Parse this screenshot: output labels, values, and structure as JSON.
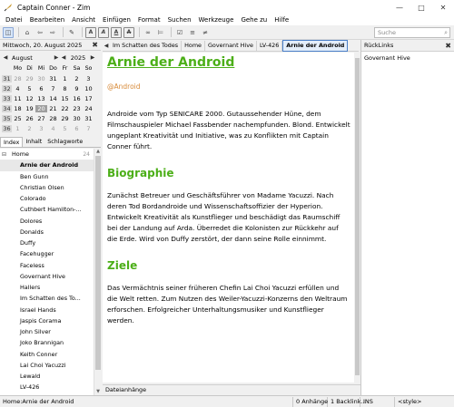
{
  "window": {
    "title": "Captain Conner - Zim"
  },
  "menu": [
    "Datei",
    "Bearbeiten",
    "Ansicht",
    "Einfügen",
    "Format",
    "Suchen",
    "Werkzeuge",
    "Gehe zu",
    "Hilfe"
  ],
  "toolbar": {
    "search_placeholder": "Suche"
  },
  "sidebar": {
    "date": "Mittwoch, 20. August 2025",
    "calendar": {
      "month": "August",
      "year": "2025",
      "weekdays": [
        "Mo",
        "Di",
        "Mi",
        "Do",
        "Fr",
        "Sa",
        "So"
      ],
      "weeks": [
        {
          "wk": "31",
          "days": [
            "28",
            "29",
            "30",
            "31",
            "1",
            "2",
            "3"
          ]
        },
        {
          "wk": "32",
          "days": [
            "4",
            "5",
            "6",
            "7",
            "8",
            "9",
            "10"
          ]
        },
        {
          "wk": "33",
          "days": [
            "11",
            "12",
            "13",
            "14",
            "15",
            "16",
            "17"
          ]
        },
        {
          "wk": "34",
          "days": [
            "18",
            "19",
            "20",
            "21",
            "22",
            "23",
            "24"
          ]
        },
        {
          "wk": "35",
          "days": [
            "25",
            "26",
            "27",
            "28",
            "29",
            "30",
            "31"
          ]
        },
        {
          "wk": "36",
          "days": [
            "1",
            "2",
            "3",
            "4",
            "5",
            "6",
            "7"
          ]
        }
      ]
    },
    "tabs": [
      "Index",
      "Inhalt",
      "Schlagworte"
    ],
    "tree_root": {
      "label": "Home",
      "count": "24"
    },
    "tree_items": [
      "Arnie der Android",
      "Ben Gunn",
      "Christian Olsen",
      "Colorado",
      "Cuthbert Hamilton-...",
      "Dolores",
      "Donalds",
      "Duffy",
      "Facehugger",
      "Faceless",
      "Governant Hive",
      "Hallers",
      "Im Schatten des To...",
      "Israel Hands",
      "Jaspis Corama",
      "John Silver",
      "Joko Brannigan",
      "Keith Conner",
      "Lai Choi Yacuzzi",
      "Lewald",
      "LV-426"
    ]
  },
  "pathbar": [
    "Im Schatten des Todes",
    "Home",
    "Governant Hive",
    "LV-426",
    "Arnie der Android"
  ],
  "page": {
    "title": "Arnie der Android",
    "tag": "@Android",
    "intro": "Androide vom Typ SENICARE 2000. Gutaussehender Hüne, dem Filmschauspieler Michael Fassbender nachempfunden. Blond. Entwickelt ungeplant Kreativität und Initiative, was zu Konflikten mit Captain Conner führt.",
    "h_bio": "Biographie",
    "bio": "Zunächst Betreuer und Geschäftsführer von Madame Yacuzzi. Nach deren Tod Bordandroide und Wissenschaftsoffizier der Hyperion. Entwickelt Kreativität als Kunstflieger und beschädigt das Raumschiff bei der Landung auf Arda. Überredet die Kolonisten zur Rückkehr auf die Erde. Wird von Duffy zerstört, der dann seine Rolle einnimmt.",
    "h_goals": "Ziele",
    "goals": "Das Vermächtnis seiner früheren Chefin Lai Choi Yacuzzi erfüllen und die Welt retten. Zum Nutzen des Weiler-Yacuzzi-Konzerns den Weltraum erforschen. Erfolgreicher Unterhaltungsmusiker und Kunstflieger werden."
  },
  "attachments": "Dateianhänge",
  "backlinks": {
    "header": "RückLinks",
    "items": [
      "Governant Hive"
    ]
  },
  "status": {
    "path": "Home:Arnie der Android",
    "attachments": "0 Anhänge",
    "backlinks": "1 Backlink...",
    "mode": "INS",
    "style": "<style>"
  }
}
